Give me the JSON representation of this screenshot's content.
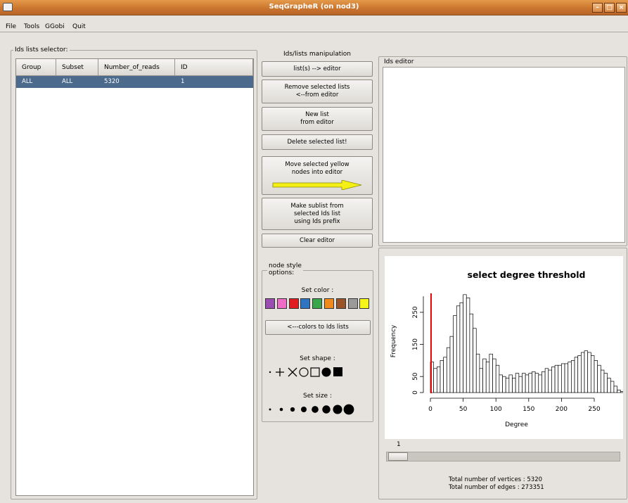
{
  "window": {
    "title": "SeqGrapheR (on nod3)"
  },
  "menubar": {
    "items": [
      "File",
      "Tools",
      "GGobi",
      "Quit"
    ]
  },
  "ids_selector": {
    "label": "Ids lists selector:",
    "columns": [
      "Group",
      "Subset",
      "Number_of_reads",
      "ID"
    ],
    "rows": [
      {
        "group": "ALL",
        "subset": "ALL",
        "reads": "5320",
        "id": "1"
      }
    ]
  },
  "manipulation": {
    "label": "Ids/lists manipulation",
    "list_to_editor": "list(s) --> editor",
    "remove_selected_1": "Remove selected lists",
    "remove_selected_2": "<--from editor",
    "new_list_1": "New list",
    "new_list_2": "from editor",
    "delete_selected": "Delete selected list!",
    "move_yellow_1": "Move selected yellow",
    "move_yellow_2": "nodes into editor",
    "sublist_1": "Make sublist from",
    "sublist_2": "selected Ids list",
    "sublist_3": "using Ids prefix",
    "clear_editor": "Clear editor"
  },
  "node_style": {
    "label_1": "node style",
    "label_2": "options:",
    "set_color": "Set color :",
    "colors": [
      "#9a4fb0",
      "#f06ac8",
      "#e01b22",
      "#2f74c0",
      "#3aa64a",
      "#f08a1c",
      "#9a5428",
      "#9a9a9a",
      "#f5f518"
    ],
    "colors_to_lists": "<---colors to Ids lists",
    "set_shape": "Set shape :",
    "shapes": [
      "dot",
      "plus",
      "cross",
      "circle",
      "square",
      "filled-circle",
      "filled-square"
    ],
    "set_size": "Set size :",
    "sizes": [
      1,
      2,
      3,
      4,
      5,
      6,
      7,
      8
    ]
  },
  "ids_editor": {
    "label": "Ids editor"
  },
  "plot": {
    "slider_value": "1",
    "total_vertices": "Total number of vertices :  5320",
    "total_edges": "Total number of edges :  273351"
  },
  "chart_data": {
    "type": "bar",
    "title": "select degree threshold",
    "xlabel": "Degree",
    "ylabel": "Frequency",
    "xlim": [
      0,
      250
    ],
    "ylim": [
      0,
      320
    ],
    "xticks": [
      "0",
      "50",
      "100",
      "150",
      "200",
      "250"
    ],
    "yticks": [
      "0",
      "50",
      "150",
      "250"
    ],
    "threshold": 1,
    "bin_width": 5,
    "values": [
      95,
      75,
      80,
      100,
      110,
      140,
      175,
      240,
      270,
      280,
      305,
      295,
      245,
      200,
      120,
      75,
      105,
      95,
      120,
      105,
      85,
      55,
      50,
      45,
      55,
      45,
      60,
      50,
      60,
      55,
      60,
      65,
      60,
      55,
      65,
      75,
      70,
      80,
      85,
      85,
      90,
      90,
      95,
      100,
      110,
      115,
      125,
      130,
      125,
      115,
      100,
      85,
      70,
      60,
      45,
      35,
      20,
      8,
      3,
      1
    ],
    "colors": {
      "bars": "#ffffff",
      "threshold": "#e00000"
    }
  }
}
